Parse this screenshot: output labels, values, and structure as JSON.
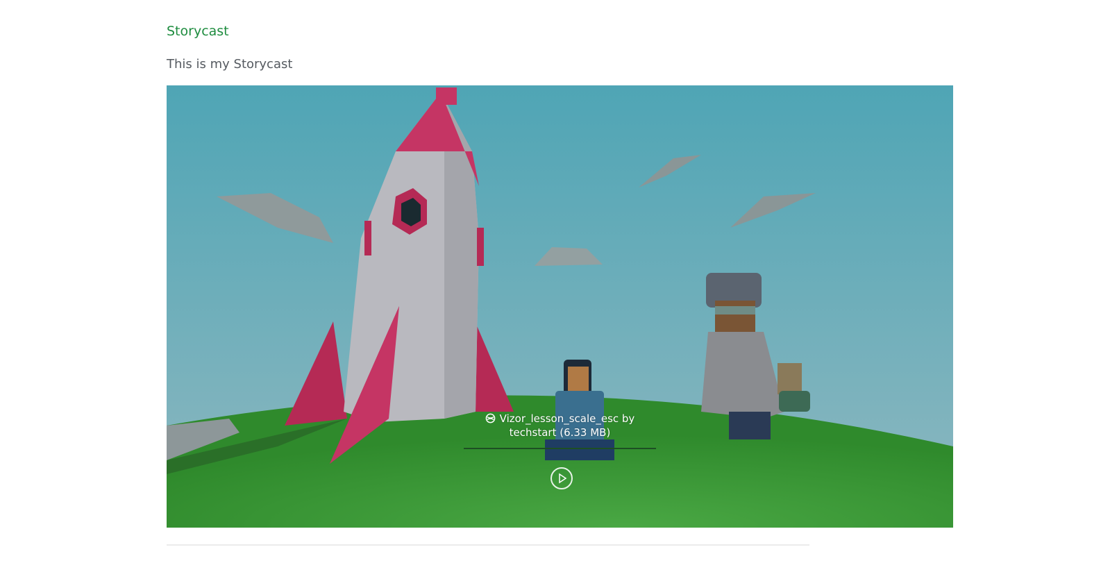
{
  "storycast": {
    "title": "Storycast",
    "description": "This is my Storycast"
  },
  "player": {
    "scene_name": "Vizor_lesson_scale_esc by",
    "scene_author_size": "techstart (6.33 MB)",
    "scene_icon": "vizor-logo-icon",
    "progress_percent": 0,
    "play_icon": "play-icon",
    "colors": {
      "sky": "#5aa6b4",
      "ground": "#3d9a3a",
      "accent": "#1e8c3f"
    }
  }
}
